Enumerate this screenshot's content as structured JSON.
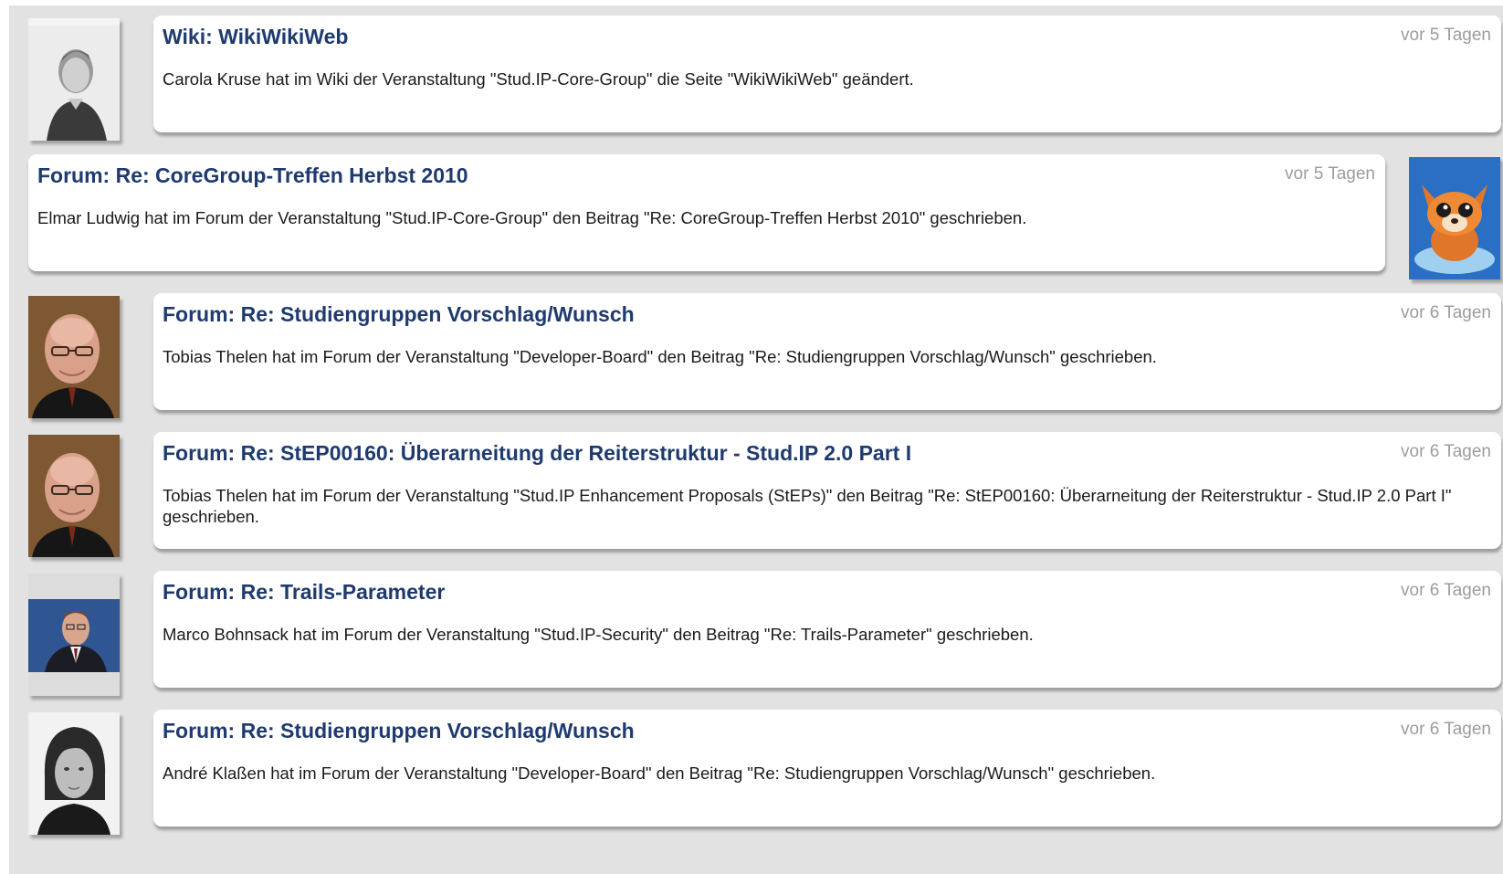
{
  "activity_feed": [
    {
      "side": "left",
      "title": "Wiki: WikiWikiWeb",
      "time": "vor 5 Tagen",
      "text": "Carola Kruse hat im Wiki der Veranstaltung \"Stud.IP-Core-Group\" die Seite \"WikiWikiWeb\" geändert.",
      "avatar_icon": "avatar-woman-photo"
    },
    {
      "side": "right",
      "title": "Forum: Re: CoreGroup-Treffen Herbst 2010",
      "time": "vor 5 Tagen",
      "text": "Elmar Ludwig hat im Forum der Veranstaltung \"Stud.IP-Core-Group\" den Beitrag \"Re: CoreGroup-Treffen Herbst 2010\" geschrieben.",
      "avatar_icon": "avatar-cartoon-fox"
    },
    {
      "side": "left",
      "title": "Forum: Re: Studiengruppen Vorschlag/Wunsch",
      "time": "vor 6 Tagen",
      "text": "Tobias Thelen hat im Forum der Veranstaltung \"Developer-Board\" den Beitrag \"Re: Studiengruppen Vorschlag/Wunsch\" geschrieben.",
      "avatar_icon": "avatar-man-glasses-photo"
    },
    {
      "side": "left",
      "title": "Forum: Re: StEP00160: Überarneitung der Reiterstruktur - Stud.IP 2.0 Part I",
      "time": "vor 6 Tagen",
      "text": "Tobias Thelen hat im Forum der Veranstaltung \"Stud.IP Enhancement Proposals (StEPs)\" den Beitrag \"Re: StEP00160: Überarneitung der Reiterstruktur - Stud.IP 2.0 Part I\" geschrieben.",
      "avatar_icon": "avatar-man-glasses-photo"
    },
    {
      "side": "left",
      "title": "Forum: Re: Trails-Parameter",
      "time": "vor 6 Tagen",
      "text": "Marco Bohnsack hat im Forum der Veranstaltung \"Stud.IP-Security\" den Beitrag \"Re: Trails-Parameter\" geschrieben.",
      "avatar_icon": "avatar-man-suit-photo"
    },
    {
      "side": "left",
      "title": "Forum: Re: Studiengruppen Vorschlag/Wunsch",
      "time": "vor 6 Tagen",
      "text": "André Klaßen hat im Forum der Veranstaltung \"Developer-Board\" den Beitrag \"Re: Studiengruppen Vorschlag/Wunsch\" geschrieben.",
      "avatar_icon": "avatar-young-man-photo"
    }
  ],
  "colors": {
    "title": "#1e3a6e",
    "time": "#9c9c9c",
    "background": "#e2e2e2",
    "bubble": "#ffffff"
  }
}
